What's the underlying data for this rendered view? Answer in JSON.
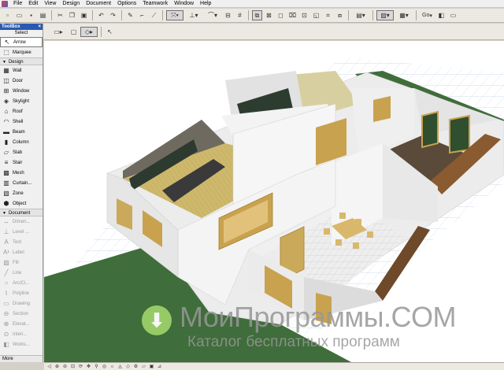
{
  "menu": {
    "items": [
      "File",
      "Edit",
      "View",
      "Design",
      "Document",
      "Options",
      "Teamwork",
      "Window",
      "Help"
    ]
  },
  "toolbar2": {
    "go_label": "Go"
  },
  "toolbox": {
    "title": "ToolBox",
    "close": "×",
    "select_header": "Select",
    "select_tools": [
      {
        "label": "Arrow",
        "icon": "arrow-icon",
        "glyph": "↖",
        "active": true
      },
      {
        "label": "Marquee",
        "icon": "marquee-icon",
        "glyph": "⬚",
        "active": false
      }
    ],
    "design_header": "Design",
    "design_tools": [
      {
        "label": "Wall",
        "icon": "wall-icon",
        "glyph": "▦"
      },
      {
        "label": "Door",
        "icon": "door-icon",
        "glyph": "◫"
      },
      {
        "label": "Window",
        "icon": "window-icon",
        "glyph": "⊞"
      },
      {
        "label": "Skylight",
        "icon": "skylight-icon",
        "glyph": "◈"
      },
      {
        "label": "Roof",
        "icon": "roof-icon",
        "glyph": "⌂"
      },
      {
        "label": "Shell",
        "icon": "shell-icon",
        "glyph": "◠"
      },
      {
        "label": "Beam",
        "icon": "beam-icon",
        "glyph": "▬"
      },
      {
        "label": "Column",
        "icon": "column-icon",
        "glyph": "▮"
      },
      {
        "label": "Slab",
        "icon": "slab-icon",
        "glyph": "▱"
      },
      {
        "label": "Stair",
        "icon": "stair-icon",
        "glyph": "≡"
      },
      {
        "label": "Mesh",
        "icon": "mesh-icon",
        "glyph": "▩"
      },
      {
        "label": "Curtain...",
        "icon": "curtain-wall-icon",
        "glyph": "▥"
      },
      {
        "label": "Zone",
        "icon": "zone-icon",
        "glyph": "▧"
      },
      {
        "label": "Object",
        "icon": "object-icon",
        "glyph": "⬢"
      }
    ],
    "document_header": "Document",
    "document_tools": [
      {
        "label": "Dimen...",
        "icon": "dimension-icon",
        "glyph": "↔"
      },
      {
        "label": "Level ...",
        "icon": "level-icon",
        "glyph": "⊥"
      },
      {
        "label": "Text",
        "icon": "text-icon",
        "glyph": "A"
      },
      {
        "label": "Label",
        "icon": "label-icon",
        "glyph": "A¹"
      },
      {
        "label": "Fill",
        "icon": "fill-icon",
        "glyph": "▨"
      },
      {
        "label": "Line",
        "icon": "line-icon",
        "glyph": "╱"
      },
      {
        "label": "Arc/Ci...",
        "icon": "arc-circle-icon",
        "glyph": "○"
      },
      {
        "label": "Polyline",
        "icon": "polyline-icon",
        "glyph": "⌇"
      },
      {
        "label": "Drawing",
        "icon": "drawing-icon",
        "glyph": "▭"
      },
      {
        "label": "Section",
        "icon": "section-icon",
        "glyph": "⊖"
      },
      {
        "label": "Elevat...",
        "icon": "elevation-icon",
        "glyph": "⊕"
      },
      {
        "label": "Interi...",
        "icon": "interior-elevation-icon",
        "glyph": "⊙"
      },
      {
        "label": "Works...",
        "icon": "worksheet-icon",
        "glyph": "◧"
      }
    ],
    "more_label": "More"
  },
  "watermark": {
    "title": "МоиПрограммы.COM",
    "subtitle": "Каталог бесплатных программ",
    "logo_glyph": "⬇"
  },
  "colors": {
    "grass": "#3d6b3a",
    "grid": "#c8d8ec",
    "wall": "#f4f4f4",
    "wall_shade": "#dcdcdc",
    "floor_wood": "#c9b46a",
    "floor_tile": "#e9e9e9",
    "kitchen": "#2a3a30"
  }
}
